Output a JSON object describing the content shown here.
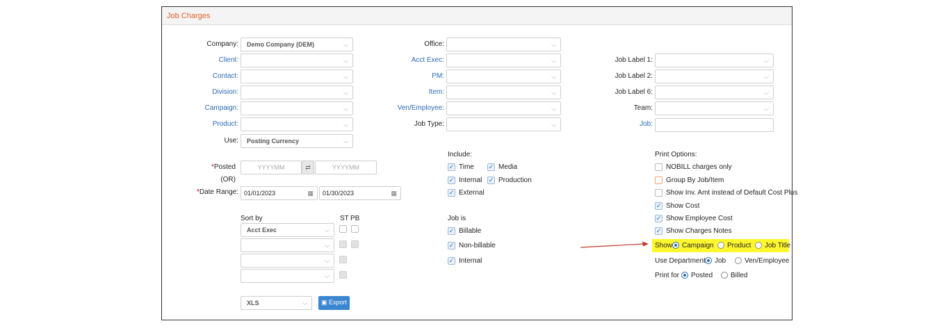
{
  "panel": {
    "title": "Job Charges"
  },
  "filters": {
    "company": {
      "label": "Company:",
      "value": "Demo Company (DEM)"
    },
    "client": {
      "label": "Client:",
      "value": ""
    },
    "contact": {
      "label": "Contact:",
      "value": ""
    },
    "division": {
      "label": "Division:",
      "value": ""
    },
    "campaign": {
      "label": "Campaign:",
      "value": ""
    },
    "product": {
      "label": "Product:",
      "value": ""
    },
    "use": {
      "label": "Use:",
      "value": "Posting Currency"
    },
    "office": {
      "label": "Office:",
      "value": ""
    },
    "acct_exec": {
      "label": "Acct Exec:",
      "value": ""
    },
    "pm": {
      "label": "PM:",
      "value": ""
    },
    "item": {
      "label": "Item:",
      "value": ""
    },
    "ven_employee": {
      "label": "Ven/Employee:",
      "value": ""
    },
    "job_type": {
      "label": "Job Type:",
      "value": ""
    },
    "job_label_1": {
      "label": "Job Label 1:",
      "value": ""
    },
    "job_label_2": {
      "label": "Job Label 2:",
      "value": ""
    },
    "job_label_6": {
      "label": "Job Label 6:",
      "value": ""
    },
    "team": {
      "label": "Team:",
      "value": ""
    },
    "job": {
      "label": "Job:",
      "value": ""
    }
  },
  "dates": {
    "posted_label": "Posted",
    "req_mark": "*",
    "posted_from_ph": "YYYYMM",
    "posted_to_ph": "YYYYMM",
    "swap_glyph": "⇄",
    "or_text": "(OR)",
    "range_label": "Date Range:",
    "range_from": "01/01/2023",
    "range_to": "01/30/2023"
  },
  "include": {
    "heading": "Include:",
    "time": "Time",
    "media": "Media",
    "internal": "Internal",
    "production": "Production",
    "external": "External"
  },
  "job_is": {
    "heading": "Job is",
    "billable": "Billable",
    "non_billable": "Non-billable",
    "internal": "Internal"
  },
  "sort": {
    "heading": "Sort by",
    "st": "ST",
    "pb": "PB",
    "first": "Acct Exec"
  },
  "export": {
    "format": "XLS",
    "button": "Export"
  },
  "print_options": {
    "heading": "Print Options:",
    "nobill": "NOBILL charges only",
    "group_by": "Group By Job/Item",
    "show_inv": "Show Inv. Amt instead of Default Cost Plus",
    "show_cost": "Show Cost",
    "show_emp_cost": "Show Employee Cost",
    "show_notes": "Show Charges Notes",
    "show_label": "Show",
    "show_campaign": "Campaign",
    "show_product": "Product",
    "show_job_title": "Job Title",
    "use_dept_label": "Use Department",
    "dept_job": "Job",
    "dept_ven": "Ven/Employee",
    "print_for_label": "Print for",
    "pf_posted": "Posted",
    "pf_billed": "Billed"
  },
  "colors": {
    "accent": "#2a6ab4",
    "title": "#e5622a",
    "highlight": "#fff72e",
    "arrow": "#c0392b"
  },
  "glyphs": {
    "chevron": "⌵",
    "calendar": "▦",
    "check": "✓",
    "export_icon": "▣"
  }
}
